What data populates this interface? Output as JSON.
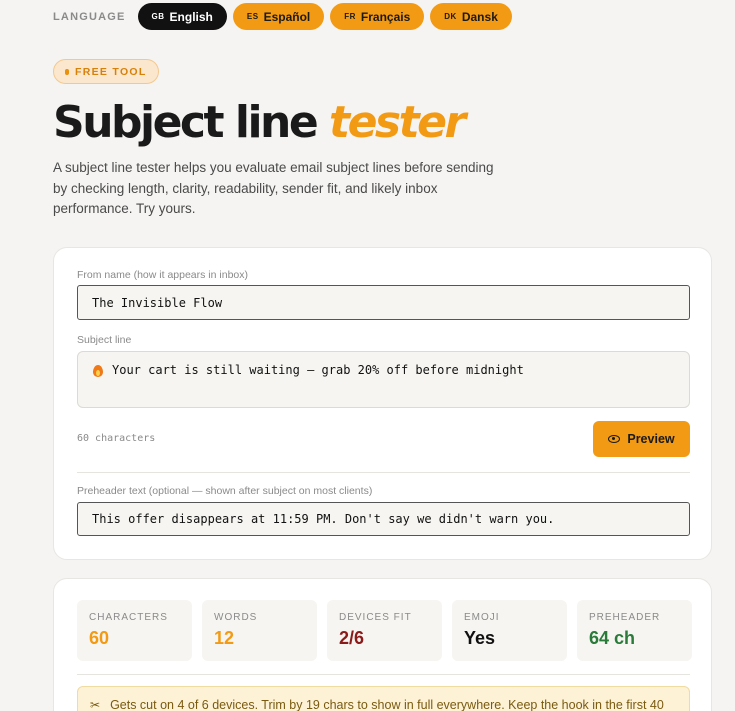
{
  "language": {
    "label": "LANGUAGE",
    "options": [
      {
        "code": "GB",
        "name": "English",
        "active": true
      },
      {
        "code": "ES",
        "name": "Español",
        "active": false
      },
      {
        "code": "FR",
        "name": "Français",
        "active": false
      },
      {
        "code": "DK",
        "name": "Dansk",
        "active": false
      }
    ]
  },
  "badge": "FREE TOOL",
  "title": {
    "main": "Subject line",
    "accent": "tester"
  },
  "intro": "A subject line tester helps you evaluate email subject lines before sending by checking length, clarity, readability, sender fit, and likely inbox performance. Try yours.",
  "form": {
    "from_label": "From name (how it appears in inbox)",
    "from_value": "The Invisible Flow",
    "subject_label": "Subject line",
    "subject_value": "Your cart is still waiting — grab 20% off before midnight",
    "char_count": "60 characters",
    "preview_label": "Preview",
    "preheader_label": "Preheader text (optional — shown after subject on most clients)",
    "preheader_value": "This offer disappears at 11:59 PM. Don't say we didn't warn you."
  },
  "stats": [
    {
      "label": "CHARACTERS",
      "value": "60",
      "color": "#f29a14"
    },
    {
      "label": "WORDS",
      "value": "12",
      "color": "#f29a14"
    },
    {
      "label": "DEVICES FIT",
      "value": "2/6",
      "color": "#8b1a1a"
    },
    {
      "label": "EMOJI",
      "value": "Yes",
      "color": "#111111"
    },
    {
      "label": "PREHEADER",
      "value": "64 ch",
      "color": "#2a7a3a"
    }
  ],
  "warning": "Gets cut on 4 of 6 devices. Trim by 19 chars to show in full everywhere. Keep the hook in the first 40"
}
